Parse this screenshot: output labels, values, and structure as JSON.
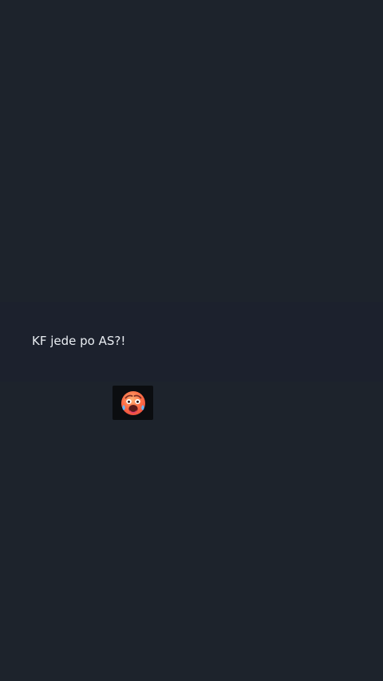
{
  "message": {
    "text": "KF jede po AS?!"
  },
  "reaction": {
    "icon": "hot-face-icon",
    "colors": {
      "face": "#f25b45",
      "chip_background": "#0b0d10",
      "sweat": "#61b7ff",
      "tongue": "#e53b6a"
    }
  }
}
